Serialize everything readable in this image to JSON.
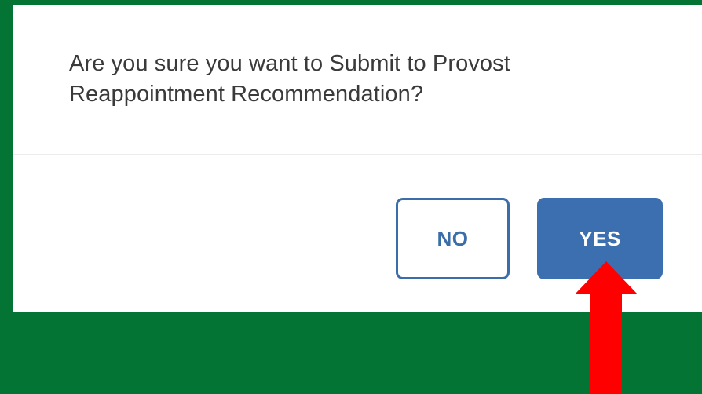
{
  "dialog": {
    "message": "Are you sure you want to Submit to Provost Reappointment Recommendation?",
    "buttons": {
      "no_label": "NO",
      "yes_label": "YES"
    }
  },
  "colors": {
    "background": "#047435",
    "dialog": "#ffffff",
    "primary": "#3b6fb0",
    "annotation_arrow": "#ff0000"
  },
  "annotation": {
    "icon": "red-arrow-up-icon"
  }
}
